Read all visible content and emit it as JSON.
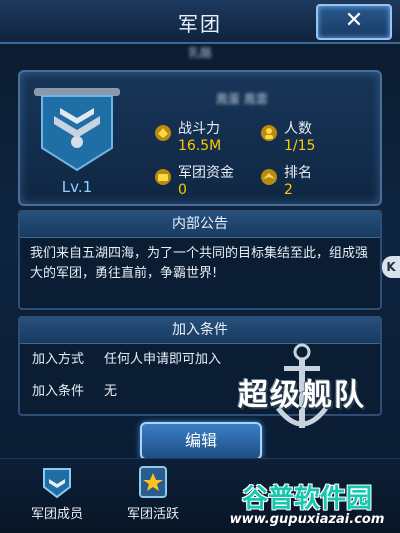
{
  "header": {
    "title": "军团",
    "close_label": "✕"
  },
  "legion": {
    "name": "乳酪",
    "leader": "鳳蛋 鳳雲",
    "level": "Lv.1",
    "stats": [
      {
        "label": "战斗力",
        "value": "16.5M",
        "icon": "power-icon"
      },
      {
        "label": "人数",
        "value": "1/15",
        "icon": "members-icon"
      },
      {
        "label": "军团资金",
        "value": "0",
        "icon": "funds-icon"
      },
      {
        "label": "排名",
        "value": "2",
        "icon": "rank-icon"
      }
    ]
  },
  "notice": {
    "title": "内部公告",
    "text": "我们来自五湖四海，为了一个共同的目标集结至此，组成强大的军团，勇往直前，争霸世界!"
  },
  "conditions": {
    "title": "加入条件",
    "rows": [
      {
        "label": "加入方式",
        "value": "任何人申请即可加入"
      },
      {
        "label": "加入条件",
        "value": "无"
      }
    ]
  },
  "edit_label": "编辑",
  "game_logo": "超级舰队",
  "side_tab": "K",
  "nav": [
    {
      "label": "军团成员",
      "icon": "members-nav-icon"
    },
    {
      "label": "军团活跃",
      "icon": "star-nav-icon"
    }
  ],
  "watermark": {
    "cn": "谷普软件园",
    "url": "www.gupuxiazai.com"
  },
  "colors": {
    "accent": "#ffc800",
    "panel": "#183558",
    "button": "#3b7fc4"
  }
}
